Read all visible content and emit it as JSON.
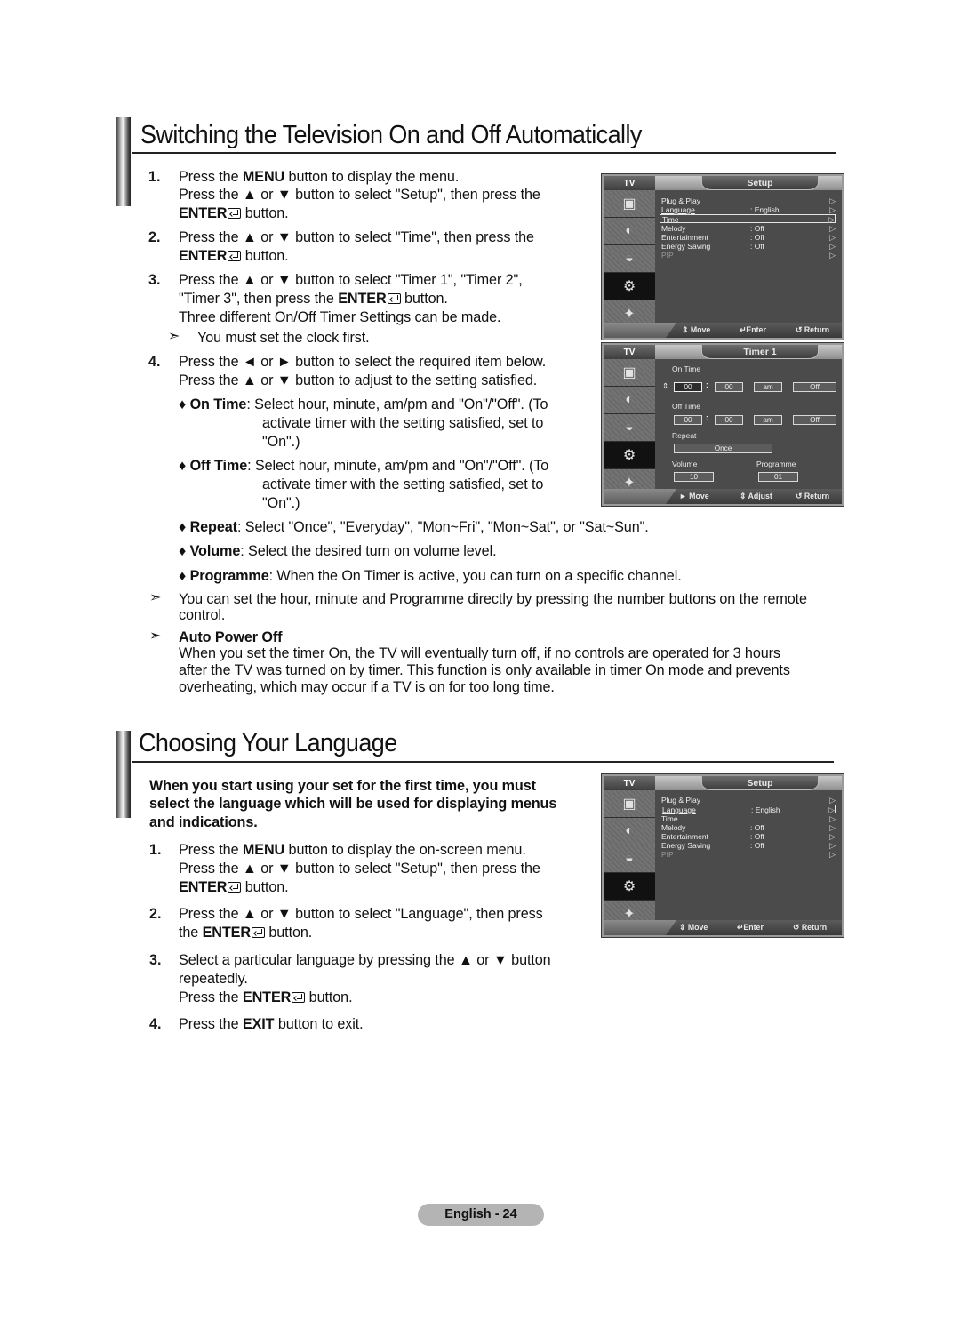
{
  "section1": {
    "title": "Switching the Television On and Off Automatically",
    "steps": [
      {
        "num": "1.",
        "lines": [
          {
            "pre": "Press the ",
            "bold": "MENU",
            "post": " button to display the menu."
          },
          {
            "pre": "Press the ▲ or ▼ button to select \"Setup\", then press the",
            "bold": "",
            "post": ""
          },
          {
            "pre": "",
            "bold": "ENTER",
            "post": " button.",
            "enter": true
          }
        ]
      },
      {
        "num": "2.",
        "lines": [
          {
            "pre": "Press the ▲ or ▼ button to select \"Time\", then press the",
            "bold": "",
            "post": ""
          },
          {
            "pre": "",
            "bold": "ENTER",
            "post": " button.",
            "enter": true
          }
        ]
      },
      {
        "num": "3.",
        "lines": [
          {
            "pre": "Press the ▲ or ▼ button to select \"Timer 1\", \"Timer 2\",",
            "bold": "",
            "post": ""
          },
          {
            "pre": "\"Timer 3\", then press the ",
            "bold": "ENTER",
            "post": " button.",
            "enter": true
          },
          {
            "pre": "Three different On/Off Timer Settings can be made.",
            "bold": "",
            "post": ""
          }
        ]
      },
      {
        "num": "4.",
        "lines": [
          {
            "pre": "Press the ◄ or ► button to select the required item below.",
            "bold": "",
            "post": ""
          },
          {
            "pre": "Press the ▲ or ▼ button to adjust to the setting satisfied.",
            "bold": "",
            "post": ""
          }
        ]
      }
    ],
    "note_clock": "You must set the clock first.",
    "bullets": {
      "on_time": {
        "label": "On  Time",
        "text1": ": Select hour, minute, am/pm and \"On\"/\"Off\". (To",
        "text2": "activate timer with the setting satisfied, set to",
        "text3": "\"On\".)"
      },
      "off_time": {
        "label": "Off  Time",
        "text1": ": Select hour, minute, am/pm and \"On\"/\"Off\". (To",
        "text2": "activate timer with the setting satisfied, set to",
        "text3": "\"On\".)"
      },
      "repeat": {
        "label": "Repeat",
        "text": ": Select \"Once\", \"Everyday\", \"Mon~Fri\", \"Mon~Sat\", or \"Sat~Sun\"."
      },
      "volume": {
        "label": "Volume",
        "text": ": Select the desired turn on volume level."
      },
      "programme": {
        "label": "Programme",
        "text": ": When the On Timer is active, you can turn on a specific channel."
      }
    },
    "note_direct": {
      "line1": "You can set the hour, minute and Programme directly by pressing the number buttons on the remote",
      "line2": "control."
    },
    "auto_power_off": {
      "heading": "Auto Power Off",
      "line1": "When you set the timer On, the TV will eventually turn off, if no controls are operated for 3 hours",
      "line2": "after the TV was turned on by timer. This function is only available in timer On mode and prevents",
      "line3": "overheating, which may occur if a TV is on for too long time."
    }
  },
  "section2": {
    "title": "Choosing Your Language",
    "intro": [
      "When you start using your set for the first time, you must",
      "select the language which will be used for displaying menus",
      "and indications."
    ],
    "steps": [
      {
        "num": "1.",
        "lines": [
          {
            "pre": "Press the ",
            "bold": "MENU",
            "post": " button to display the on-screen menu."
          },
          {
            "pre": "Press the ▲ or ▼ button to select \"Setup\", then press the",
            "bold": "",
            "post": ""
          },
          {
            "pre": "",
            "bold": "ENTER",
            "post": " button.",
            "enter": true
          }
        ]
      },
      {
        "num": "2.",
        "lines": [
          {
            "pre": "Press the ▲ or ▼ button to select \"Language\", then press",
            "bold": "",
            "post": ""
          },
          {
            "pre": "the ",
            "bold": "ENTER",
            "post": " button.",
            "enter": true
          }
        ]
      },
      {
        "num": "3.",
        "lines": [
          {
            "pre": "Select a particular language by pressing the ▲ or ▼ button",
            "bold": "",
            "post": ""
          },
          {
            "pre": "repeatedly.",
            "bold": "",
            "post": ""
          },
          {
            "pre": "Press the ",
            "bold": "ENTER",
            "post": " button.",
            "enter": true
          }
        ]
      },
      {
        "num": "4.",
        "lines": [
          {
            "pre": "Press the ",
            "bold": "EXIT",
            "post": " button to exit."
          }
        ]
      }
    ]
  },
  "osd_setup_time": {
    "tv_label": "TV",
    "tab": "Setup",
    "rows": [
      {
        "label": "Plug & Play",
        "value": ""
      },
      {
        "label": "Language",
        "value": ": English"
      },
      {
        "label": "Time",
        "value": ""
      },
      {
        "label": "Melody",
        "value": ": Off"
      },
      {
        "label": "Entertainment",
        "value": ": Off"
      },
      {
        "label": "Energy Saving",
        "value": ": Off"
      },
      {
        "label": "PIP",
        "value": ""
      }
    ],
    "highlighted": "Time",
    "hints": {
      "move": "Move",
      "enter": "Enter",
      "return": "Return"
    }
  },
  "osd_timer": {
    "tv_label": "TV",
    "tab": "Timer 1",
    "on_time_label": "On Time",
    "on_time": {
      "hour": "00",
      "minute": "00",
      "ampm": "am",
      "state": "Off"
    },
    "off_time_label": "Off Time",
    "off_time": {
      "hour": "00",
      "minute": "00",
      "ampm": "am",
      "state": "Off"
    },
    "repeat_label": "Repeat",
    "repeat": "Once",
    "volume_label": "Volume",
    "volume": "10",
    "programme_label": "Programme",
    "programme": "01",
    "hints": {
      "move": "Move",
      "adjust": "Adjust",
      "return": "Return"
    }
  },
  "osd_setup_language": {
    "tv_label": "TV",
    "tab": "Setup",
    "rows": [
      {
        "label": "Plug & Play",
        "value": ""
      },
      {
        "label": "Language",
        "value": ": English"
      },
      {
        "label": "Time",
        "value": ""
      },
      {
        "label": "Melody",
        "value": ": Off"
      },
      {
        "label": "Entertainment",
        "value": ": Off"
      },
      {
        "label": "Energy Saving",
        "value": ": Off"
      },
      {
        "label": "PIP",
        "value": ""
      }
    ],
    "highlighted": "Language",
    "hints": {
      "move": "Move",
      "enter": "Enter",
      "return": "Return"
    }
  },
  "footer": {
    "page_label": "English - 24"
  }
}
